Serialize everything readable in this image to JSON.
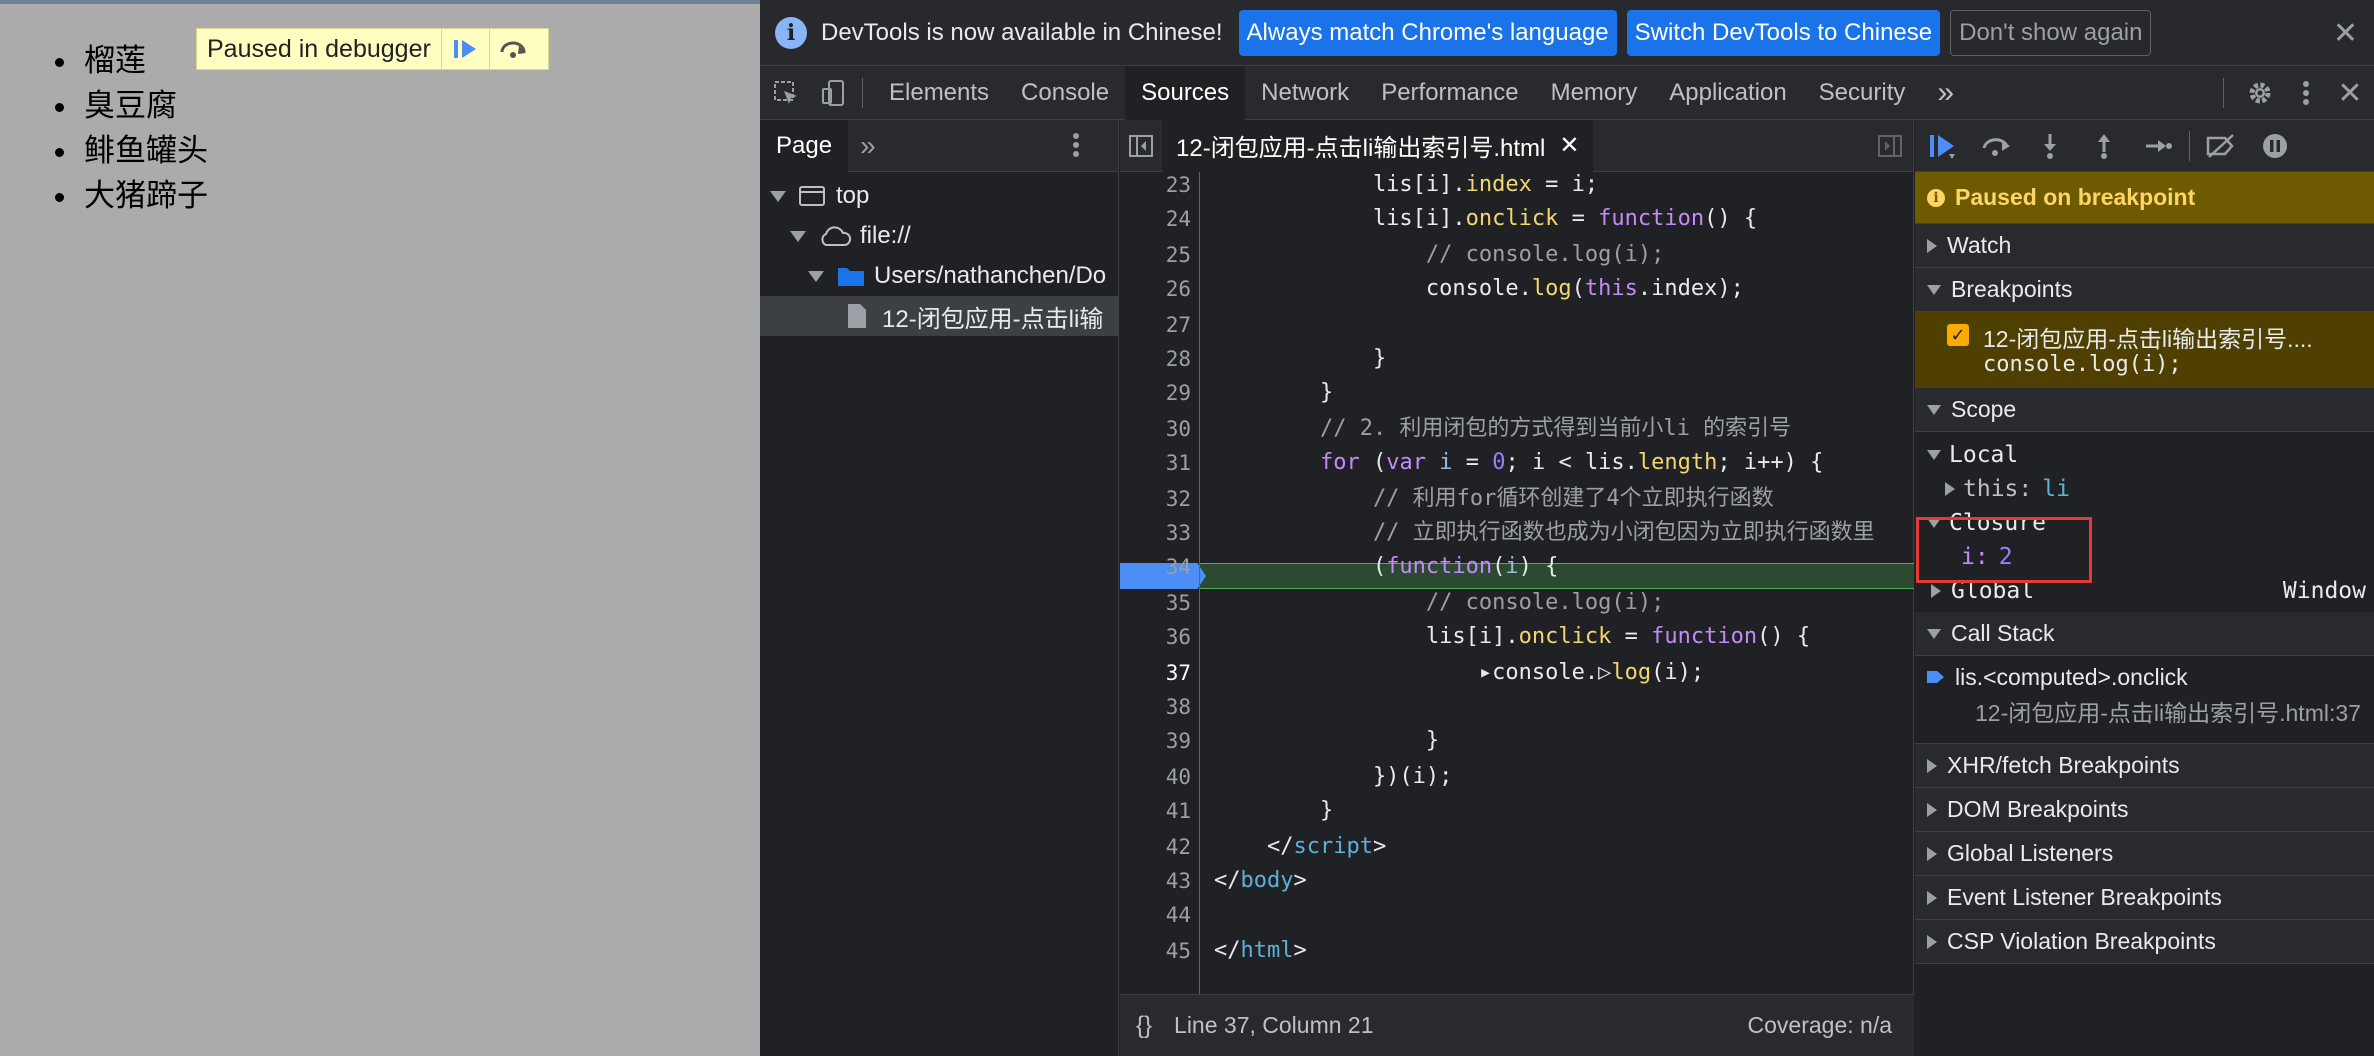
{
  "page": {
    "list_items": [
      "榴莲",
      "臭豆腐",
      "鲱鱼罐头",
      "大猪蹄子"
    ],
    "paused_banner": "Paused in debugger"
  },
  "infobar": {
    "message": "DevTools is now available in Chinese!",
    "btn_match": "Always match Chrome's language",
    "btn_switch": "Switch DevTools to Chinese",
    "btn_dismiss": "Don't show again",
    "close": "✕"
  },
  "tabs": [
    "Elements",
    "Console",
    "Sources",
    "Network",
    "Performance",
    "Memory",
    "Application",
    "Security"
  ],
  "active_tab": "Sources",
  "more_tabs": "»",
  "navigator": {
    "tab": "Page",
    "more": "»",
    "tree": [
      "top",
      "file://",
      "Users/nathanchen/Do",
      "12-闭包应用-点击li输"
    ]
  },
  "editor": {
    "file_tab": "12-闭包应用-点击li输出索引号.html",
    "close": "✕",
    "status": {
      "format": "{}",
      "position": "Line 37, Column 21",
      "coverage": "Coverage: n/a"
    },
    "line_numbers": [
      "23",
      "24",
      "25",
      "26",
      "27",
      "28",
      "29",
      "30",
      "31",
      "32",
      "33",
      "34",
      "35",
      "36",
      "37",
      "38",
      "39",
      "40",
      "41",
      "42",
      "43",
      "44",
      "45"
    ]
  },
  "debugger": {
    "paused": "Paused on breakpoint",
    "watch": "Watch",
    "breakpoints": "Breakpoints",
    "bp_file": "12-闭包应用-点击li输出索引号....",
    "bp_code": "console.log(i);",
    "scope": "Scope",
    "local": "Local",
    "local_this_key": "this:",
    "local_this_val": "li",
    "closure": "Closure",
    "closure_key": "i:",
    "closure_val": "2",
    "global": "Global",
    "global_val": "Window",
    "call_stack": "Call Stack",
    "cs_fn": "lis.<computed>.onclick",
    "cs_loc": "12-闭包应用-点击li输出索引号.html:37",
    "xhr": "XHR/fetch Breakpoints",
    "dom": "DOM Breakpoints",
    "global_listeners": "Global Listeners",
    "event_listeners": "Event Listener Breakpoints",
    "csp": "CSP Violation Breakpoints"
  },
  "colors": {
    "accent": "#1a73e8",
    "paused_bg": "#6e5a00",
    "highlight": "#e53935"
  }
}
